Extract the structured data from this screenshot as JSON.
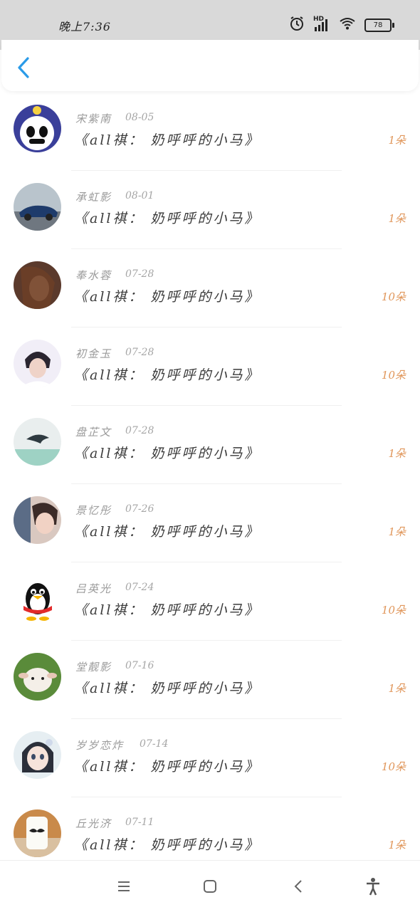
{
  "status_bar": {
    "time": "晚上7:36",
    "battery": "78",
    "network_label": "HD",
    "icons": [
      "alarm-icon",
      "cellular-signal-icon",
      "wifi-icon",
      "battery-icon"
    ]
  },
  "header": {
    "back_icon": "chevron-left-icon",
    "accent_color": "#2b9be8"
  },
  "items": [
    {
      "name": "宋紫南",
      "date": "08-05",
      "title": "《all祺： 奶呼呼的小马》",
      "count": "1朵",
      "avatar": "panda-character"
    },
    {
      "name": "承虹影",
      "date": "08-01",
      "title": "《all祺： 奶呼呼的小马》",
      "count": "1朵",
      "avatar": "blue-car"
    },
    {
      "name": "奉水蓉",
      "date": "07-28",
      "title": "《all祺： 奶呼呼的小马》",
      "count": "10朵",
      "avatar": "girl-brown-hair"
    },
    {
      "name": "初金玉",
      "date": "07-28",
      "title": "《all祺： 奶呼呼的小马》",
      "count": "10朵",
      "avatar": "young-man"
    },
    {
      "name": "盘芷文",
      "date": "07-28",
      "title": "《all祺： 奶呼呼的小马》",
      "count": "1朵",
      "avatar": "dolphin"
    },
    {
      "name": "景忆彤",
      "date": "07-26",
      "title": "《all祺： 奶呼呼的小马》",
      "count": "1朵",
      "avatar": "girl-selfie"
    },
    {
      "name": "吕英光",
      "date": "07-24",
      "title": "《all祺： 奶呼呼的小马》",
      "count": "10朵",
      "avatar": "qq-penguin"
    },
    {
      "name": "堂靓影",
      "date": "07-16",
      "title": "《all祺： 奶呼呼的小马》",
      "count": "1朵",
      "avatar": "lamb"
    },
    {
      "name": "岁岁恋炸",
      "date": "07-14",
      "title": "《all祺： 奶呼呼的小马》",
      "count": "10朵",
      "avatar": "anime-girl"
    },
    {
      "name": "丘光济",
      "date": "07-11",
      "title": "《all祺： 奶呼呼的小马》",
      "count": "1朵",
      "avatar": "milk-mustache"
    }
  ],
  "count_color": "#e0965a",
  "nav": {
    "icons": [
      "menu-icon",
      "home-square-icon",
      "back-triangle-icon",
      "accessibility-icon"
    ]
  }
}
